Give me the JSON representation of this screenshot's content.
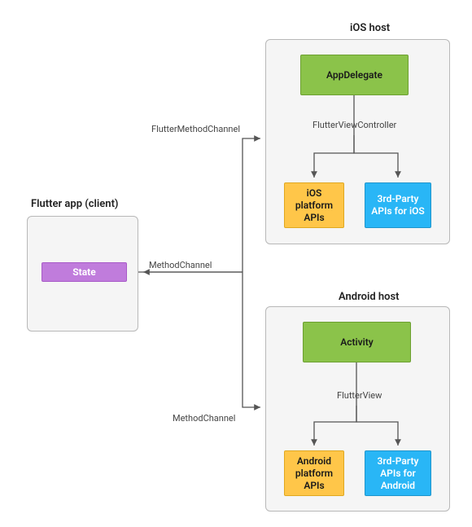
{
  "flutter_client": {
    "title": "Flutter app (client)",
    "state_label": "State"
  },
  "ios_host": {
    "title": "iOS host",
    "app_delegate": "AppDelegate",
    "view_controller_label": "FlutterViewController",
    "platform_apis": "iOS platform APIs",
    "third_party": "3rd-Party APIs for iOS"
  },
  "android_host": {
    "title": "Android host",
    "activity": "Activity",
    "view_label": "FlutterView",
    "platform_apis": "Android platform APIs",
    "third_party": "3rd-Party APIs for Android"
  },
  "channels": {
    "ios_channel": "FlutterMethodChannel",
    "method_channel_top": "MethodChannel",
    "method_channel_bottom": "MethodChannel"
  },
  "colors": {
    "green": "#8bc34a",
    "orange": "#ffc649",
    "blue": "#29b6f6",
    "purple": "#c07cdc",
    "panel": "#f5f5f5",
    "border": "#b8b8b8"
  }
}
